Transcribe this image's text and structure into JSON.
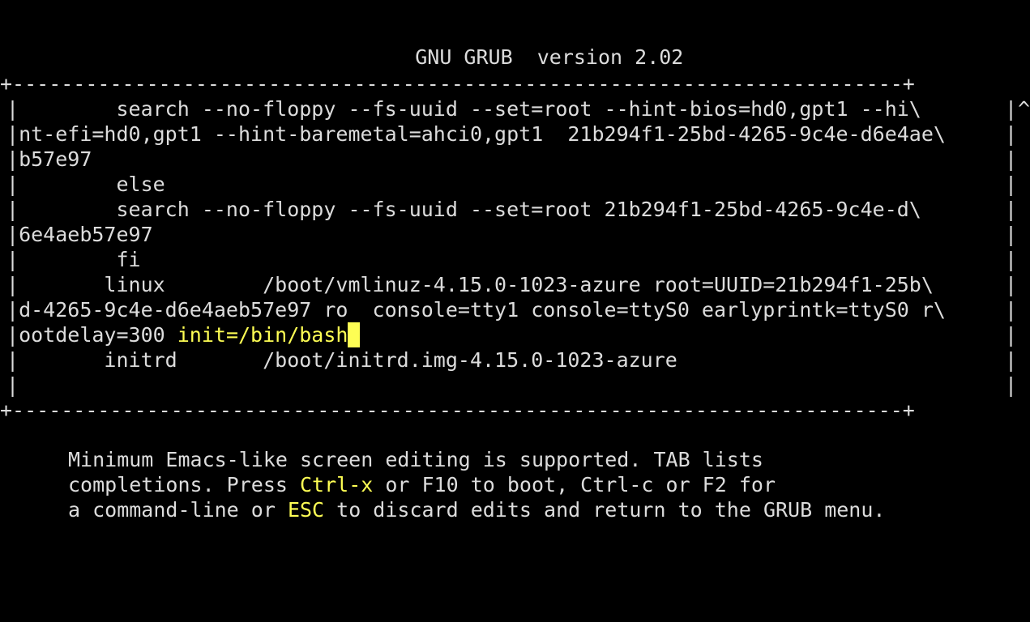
{
  "screen": {
    "background_color": "#000000",
    "foreground_color": "#dcdcdc",
    "highlight_color": "#fefe54",
    "title": "GNU GRUB  version 2.02"
  },
  "edit_box": {
    "border_top": "+-------------------------------------------------------------------------+",
    "border_bottom": "+-------------------------------------------------------------------------+",
    "rail_left": "|",
    "rail_right": "|",
    "scroll_up_indicator": "^",
    "lines": [
      {
        "pre": "        search --no-floppy --fs-uuid --set=root --hint-bios=hd0,gpt1 --hi\\",
        "hl": "",
        "post": "",
        "rail_right": "|",
        "scroll": "^"
      },
      {
        "pre": "nt-efi=hd0,gpt1 --hint-baremetal=ahci0,gpt1  21b294f1-25bd-4265-9c4e-d6e4ae\\",
        "hl": "",
        "post": "",
        "rail_right": "|",
        "scroll": ""
      },
      {
        "pre": "b57e97",
        "hl": "",
        "post": "",
        "rail_right": "|",
        "scroll": ""
      },
      {
        "pre": "        else",
        "hl": "",
        "post": "",
        "rail_right": "|",
        "scroll": ""
      },
      {
        "pre": "        search --no-floppy --fs-uuid --set=root 21b294f1-25bd-4265-9c4e-d\\",
        "hl": "",
        "post": "",
        "rail_right": "|",
        "scroll": ""
      },
      {
        "pre": "6e4aeb57e97",
        "hl": "",
        "post": "",
        "rail_right": "|",
        "scroll": ""
      },
      {
        "pre": "        fi",
        "hl": "",
        "post": "",
        "rail_right": "|",
        "scroll": ""
      },
      {
        "pre": "       linux        /boot/vmlinuz-4.15.0-1023-azure root=UUID=21b294f1-25b\\",
        "hl": "",
        "post": "",
        "rail_right": "|",
        "scroll": ""
      },
      {
        "pre": "d-4265-9c4e-d6e4aeb57e97 ro  console=tty1 console=ttyS0 earlyprintk=ttyS0 r\\",
        "hl": "",
        "post": "",
        "rail_right": "|",
        "scroll": ""
      },
      {
        "pre": "ootdelay=300 ",
        "hl": "init=/bin/bash",
        "post": "",
        "cursor": true,
        "rail_right": "|",
        "scroll": ""
      },
      {
        "pre": "       initrd       /boot/initrd.img-4.15.0-1023-azure",
        "hl": "",
        "post": "",
        "rail_right": "|",
        "scroll": ""
      },
      {
        "pre": "",
        "hl": "",
        "post": "",
        "rail_right": "|",
        "scroll": ""
      }
    ]
  },
  "help": {
    "line1": {
      "a": "Minimum Emacs-like screen editing is supported. TAB lists",
      "key": "",
      "b": ""
    },
    "line2": {
      "a": "completions. Press ",
      "key": "Ctrl-x",
      "b": " or F10 to boot, Ctrl-c or F2 for"
    },
    "line3": {
      "a": "a command-line or ",
      "key": "ESC",
      "b": " to discard edits and return to the GRUB menu."
    }
  }
}
